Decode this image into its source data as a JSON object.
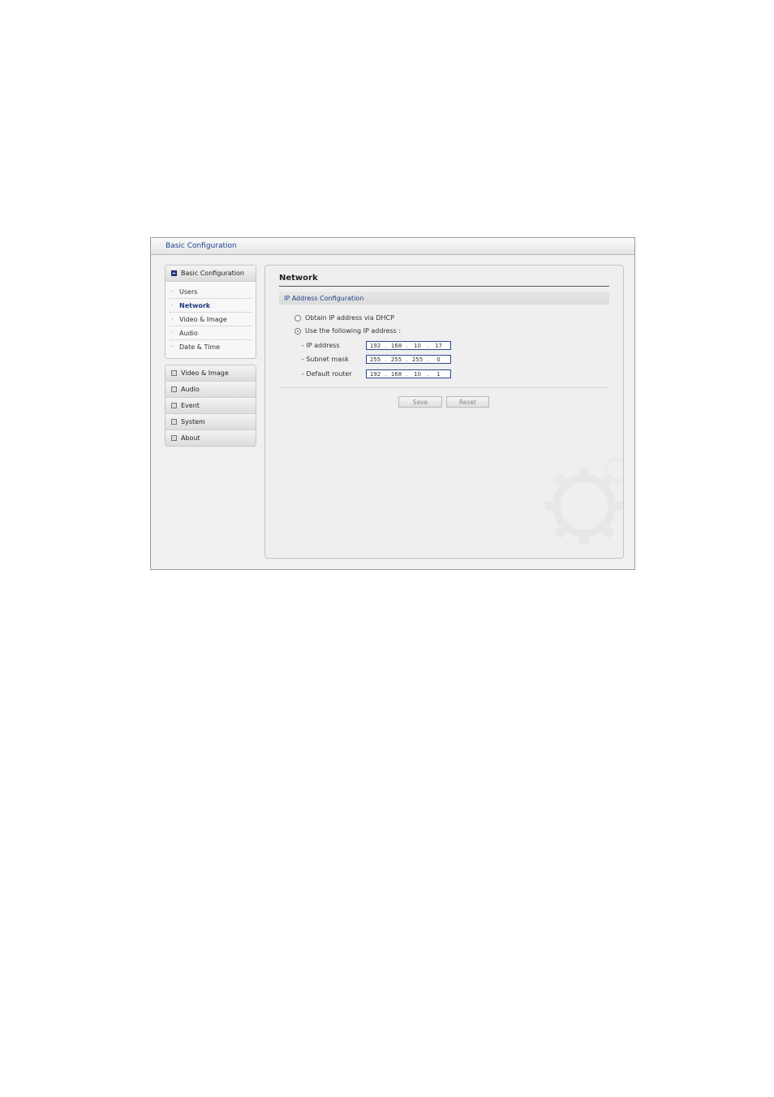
{
  "window": {
    "title": "Basic Configuration"
  },
  "sidebar": {
    "open_group": {
      "label": "Basic Configuration",
      "items": [
        {
          "label": "Users",
          "active": false
        },
        {
          "label": "Network",
          "active": true
        },
        {
          "label": "Video & Image",
          "active": false
        },
        {
          "label": "Audio",
          "active": false
        },
        {
          "label": "Date & Time",
          "active": false
        }
      ]
    },
    "groups": [
      {
        "label": "Video & Image"
      },
      {
        "label": "Audio"
      },
      {
        "label": "Event"
      },
      {
        "label": "System"
      },
      {
        "label": "About"
      }
    ]
  },
  "main": {
    "title": "Network",
    "section": "IP Address Configuration",
    "radio_dhcp": {
      "label": "Obtain IP address via DHCP",
      "checked": false
    },
    "radio_static": {
      "label": "Use the following IP address :",
      "checked": true
    },
    "fields": [
      {
        "label": "- IP address",
        "octets": [
          "192",
          "168",
          "10",
          "17"
        ]
      },
      {
        "label": "- Subnet mask",
        "octets": [
          "255",
          "255",
          "255",
          "0"
        ]
      },
      {
        "label": "- Default router",
        "octets": [
          "192",
          "168",
          "10",
          "1"
        ]
      }
    ],
    "save_label": "Save",
    "reset_label": "Reset",
    "colors": {
      "title_blue": "#1d3f8c",
      "active_nav": "#1d3a80",
      "field_border": "#2a4a8a"
    }
  }
}
